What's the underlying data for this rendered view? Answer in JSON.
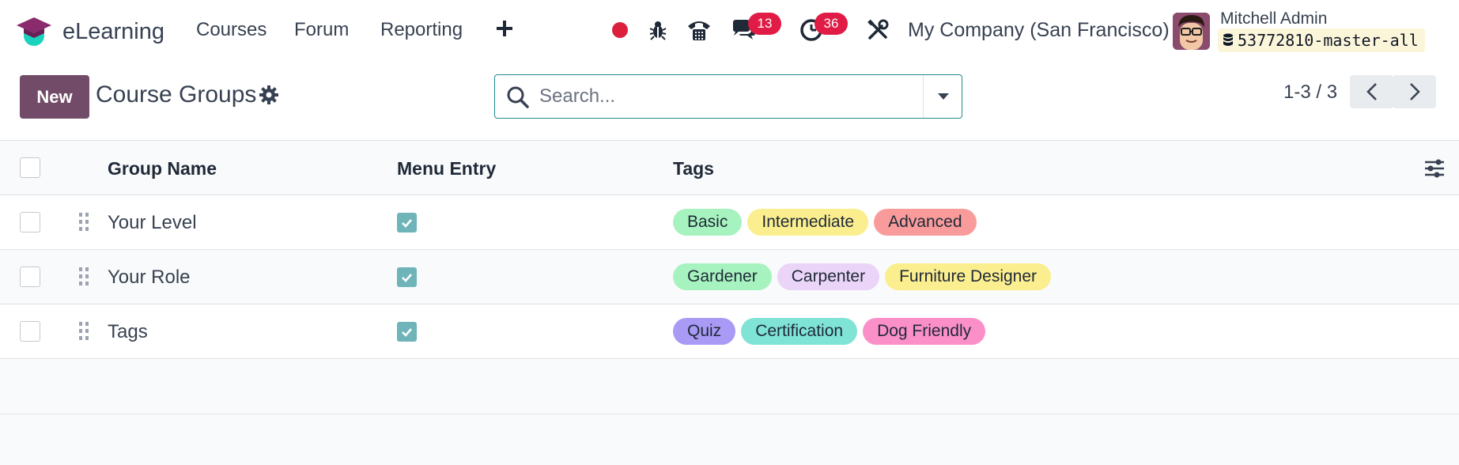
{
  "navbar": {
    "app_name": "eLearning",
    "menu": [
      "Courses",
      "Forum",
      "Reporting"
    ],
    "messages_count": "13",
    "activities_count": "36",
    "company": "My Company (San Francisco)",
    "user_name": "Mitchell Admin",
    "database": "53772810-master-all"
  },
  "control": {
    "new_label": "New",
    "title": "Course Groups",
    "search_placeholder": "Search...",
    "pager": "1-3 / 3"
  },
  "list": {
    "columns": [
      "Group Name",
      "Menu Entry",
      "Tags"
    ],
    "rows": [
      {
        "name": "Your Level",
        "menu_entry": true,
        "tags": [
          {
            "label": "Basic",
            "color": "#a7f3c0"
          },
          {
            "label": "Intermediate",
            "color": "#fbee8f"
          },
          {
            "label": "Advanced",
            "color": "#f99b9b"
          }
        ]
      },
      {
        "name": "Your Role",
        "menu_entry": true,
        "tags": [
          {
            "label": "Gardener",
            "color": "#a7f3c0"
          },
          {
            "label": "Carpenter",
            "color": "#ead4f8"
          },
          {
            "label": "Furniture Designer",
            "color": "#fbee8f"
          }
        ]
      },
      {
        "name": "Tags",
        "menu_entry": true,
        "tags": [
          {
            "label": "Quiz",
            "color": "#a99af5"
          },
          {
            "label": "Certification",
            "color": "#7fe3d6"
          },
          {
            "label": "Dog Friendly",
            "color": "#fb8fc8"
          }
        ]
      }
    ]
  },
  "colors": {
    "brand": "#714b67",
    "accent": "#1f8a8a",
    "badge": "#e01b45"
  }
}
